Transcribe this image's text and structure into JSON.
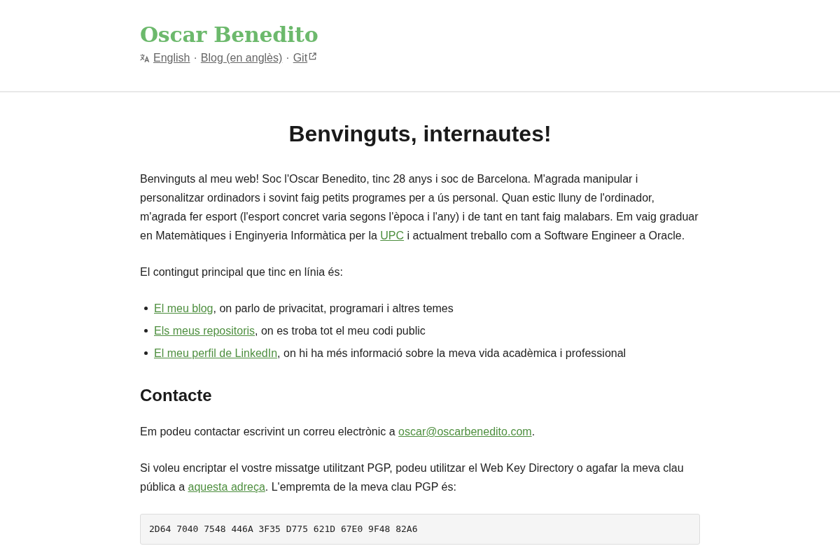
{
  "header": {
    "title": "Oscar Benedito",
    "nav": [
      {
        "kind": "link",
        "text": "English",
        "external": false
      },
      {
        "kind": "separator",
        "text": "·"
      },
      {
        "kind": "link",
        "text": "Blog (en anglès)",
        "external": false
      },
      {
        "kind": "separator",
        "text": "·"
      },
      {
        "kind": "link",
        "text": "Git",
        "external": true
      }
    ]
  },
  "main": {
    "heading": "Benvinguts, internautes!",
    "blocks": [
      {
        "kind": "paragraph",
        "segments": [
          {
            "kind": "text",
            "text": "Benvinguts al meu web! Soc l'Oscar Benedito, tinc 28 anys i soc de Barcelona. M'agrada manipular i personalitzar ordinadors i sovint faig petits programes per a ús personal. Quan estic lluny de l'ordinador, m'agrada fer esport (l'esport concret varia segons l'època i l'any) i de tant en tant faig malabars. Em vaig graduar en Matemàtiques i Enginyeria Informàtica per la "
          },
          {
            "kind": "link",
            "text": "UPC"
          },
          {
            "kind": "text",
            "text": " i actualment treballo com a Software Engineer a Oracle."
          }
        ]
      },
      {
        "kind": "paragraph",
        "segments": [
          {
            "kind": "text",
            "text": "El contingut principal que tinc en línia és:"
          }
        ]
      },
      {
        "kind": "list",
        "items": [
          {
            "segments": [
              {
                "kind": "link",
                "text": "El meu blog"
              },
              {
                "kind": "text",
                "text": ", on parlo de privacitat, programari i altres temes"
              }
            ]
          },
          {
            "segments": [
              {
                "kind": "link",
                "text": "Els meus repositoris"
              },
              {
                "kind": "text",
                "text": ", on es troba tot el meu codi public"
              }
            ]
          },
          {
            "segments": [
              {
                "kind": "link",
                "text": "El meu perfil de LinkedIn"
              },
              {
                "kind": "text",
                "text": ", on hi ha més informació sobre la meva vida acadèmica i professional"
              }
            ]
          }
        ]
      },
      {
        "kind": "heading",
        "text": "Contacte"
      },
      {
        "kind": "paragraph",
        "segments": [
          {
            "kind": "text",
            "text": "Em podeu contactar escrivint un correu electrònic a "
          },
          {
            "kind": "link",
            "text": "oscar@oscarbenedito.com"
          },
          {
            "kind": "text",
            "text": "."
          }
        ]
      },
      {
        "kind": "paragraph",
        "segments": [
          {
            "kind": "text",
            "text": "Si voleu encriptar el vostre missatge utilitzant PGP, podeu utilitzar el Web Key Directory o agafar la meva clau pública a "
          },
          {
            "kind": "link",
            "text": "aquesta adreça"
          },
          {
            "kind": "text",
            "text": ". L'empremta de la meva clau PGP és:"
          }
        ]
      },
      {
        "kind": "code",
        "text": "2D64 7040 7548 446A 3F35 D775 621D 67E0 9F48 82A6"
      }
    ]
  }
}
